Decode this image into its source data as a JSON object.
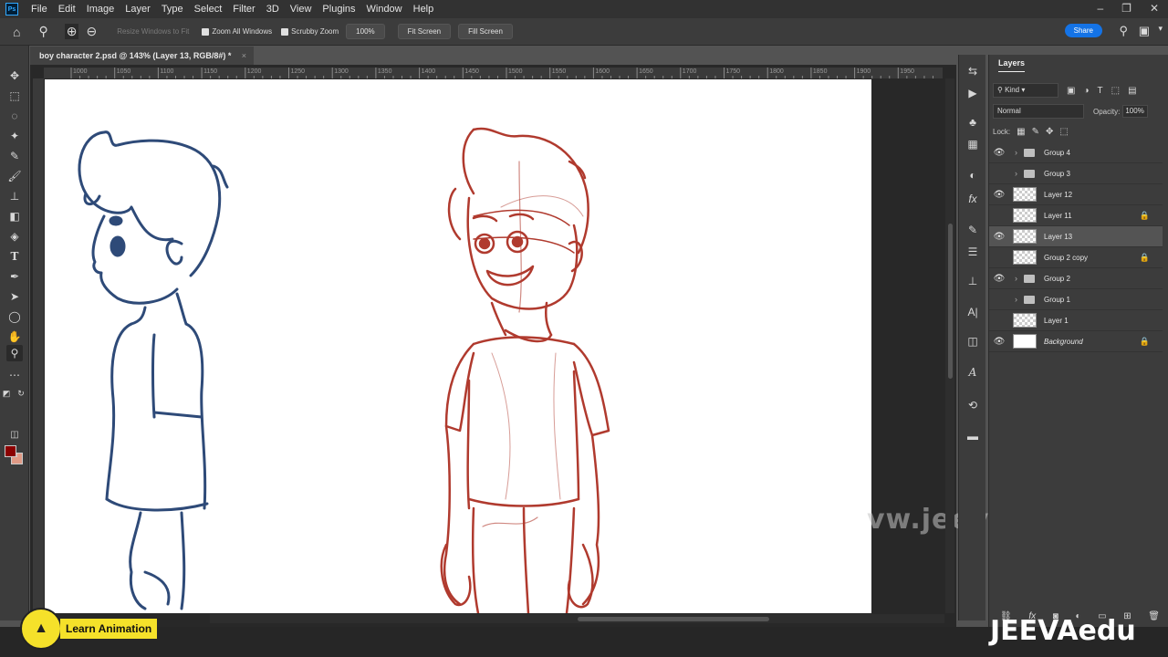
{
  "menu": {
    "logo": "Ps",
    "items": [
      "File",
      "Edit",
      "Image",
      "Layer",
      "Type",
      "Select",
      "Filter",
      "3D",
      "View",
      "Plugins",
      "Window",
      "Help"
    ],
    "window_controls": [
      "minimize-icon",
      "restore-icon",
      "close-icon"
    ]
  },
  "options": {
    "resize_windows": "Resize Windows to Fit",
    "zoom_all": "Zoom All Windows",
    "scrubby": "Scrubby Zoom",
    "zoom_value": "100%",
    "fit_screen": "Fit Screen",
    "fill_screen": "Fill Screen",
    "share": "Share"
  },
  "document": {
    "tab_title": "boy character 2.psd @ 143% (Layer 13, RGB/8#) *",
    "close": "×",
    "ruler_ticks": [
      "1000",
      "1050",
      "1100",
      "1150",
      "1200",
      "1250",
      "1300",
      "1350",
      "1400",
      "1450",
      "1500",
      "1550",
      "1600",
      "1650",
      "1700",
      "1750",
      "1800",
      "1850",
      "1900",
      "1950"
    ]
  },
  "watermark": "vw.jeevaedu.com",
  "layers_panel": {
    "tab": "Layers",
    "kind": "Kind",
    "blend_mode": "Normal",
    "opacity_label": "Opacity:",
    "opacity_value": "100%",
    "lock_label": "Lock:",
    "layers": [
      {
        "name": "Group 4",
        "type": "group",
        "visible": true,
        "locked": false
      },
      {
        "name": "Group 3",
        "type": "group",
        "visible": false,
        "locked": false
      },
      {
        "name": "Layer 12",
        "type": "layer",
        "visible": true,
        "locked": false
      },
      {
        "name": "Layer 11",
        "type": "layer",
        "visible": false,
        "locked": true
      },
      {
        "name": "Layer 13",
        "type": "layer",
        "visible": true,
        "locked": false,
        "selected": true
      },
      {
        "name": "Group 2 copy",
        "type": "layer",
        "visible": false,
        "locked": true
      },
      {
        "name": "Group 2",
        "type": "group",
        "visible": true,
        "locked": false
      },
      {
        "name": "Group 1",
        "type": "group",
        "visible": false,
        "locked": false
      },
      {
        "name": "Layer 1",
        "type": "layer",
        "visible": false,
        "locked": false
      },
      {
        "name": "Background",
        "type": "background",
        "visible": true,
        "locked": true
      }
    ]
  },
  "overlays": {
    "learn_animation": "Learn Animation",
    "jeeva_logo": "JEEVAedu"
  },
  "colors": {
    "foreground": "#8b0000",
    "background": "#e09a86",
    "accent": "#1473e6"
  }
}
